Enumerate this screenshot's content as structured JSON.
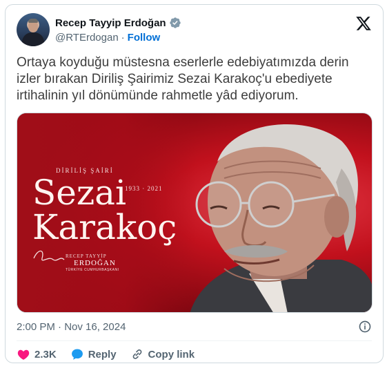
{
  "author": {
    "display_name": "Recep Tayyip Erdoğan",
    "handle": "@RTErdogan",
    "separator": "·",
    "follow_label": "Follow"
  },
  "tweet": {
    "text": "Ortaya koyduğu müstesna eserlerle edebiyatımızda derin izler bırakan Diriliş Şairimiz Sezai Karakoç'u ebediyete irtihalinin yıl dönümünde rahmetle yâd ediyorum.",
    "timestamp": "2:00 PM · Nov 16, 2024"
  },
  "poster": {
    "subtitle": "DİRİLİŞ ŞAİRİ",
    "first_name": "Sezai",
    "last_name": "Karakoç",
    "dates": "1933 · 2021",
    "sign_top": "RECEP TAYYİP",
    "sign_name": "ERDOĞAN",
    "sign_title": "TÜRKİYE CUMHURBAŞKANI"
  },
  "actions": {
    "like_count": "2.3K",
    "reply_label": "Reply",
    "copy_link_label": "Copy link"
  },
  "colors": {
    "accent": "#006fd6",
    "verified": "#829aab",
    "like": "#f91880",
    "reply": "#1d9bf0",
    "poster_red": "#c2111d"
  },
  "icons": {
    "verified": "verified-badge-icon",
    "x_logo": "x-logo-icon",
    "info": "info-icon",
    "heart": "heart-icon",
    "reply": "reply-bubble-icon",
    "link": "link-icon"
  }
}
